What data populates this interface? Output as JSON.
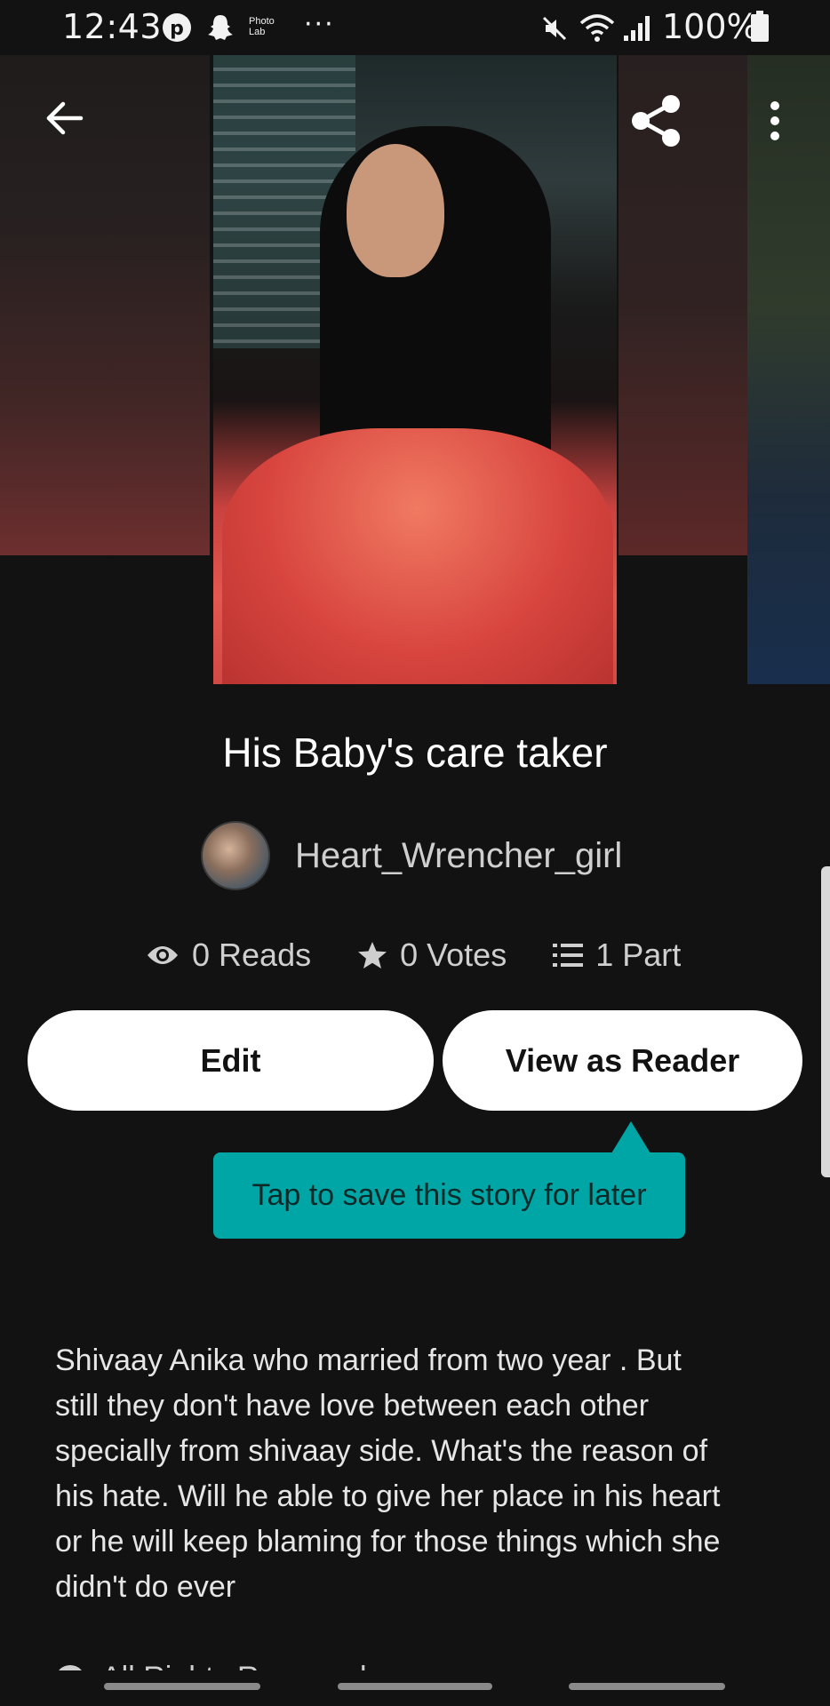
{
  "status_bar": {
    "time": "12:43",
    "app_icons": [
      "pinterest-icon",
      "snapchat-icon",
      "photo-lab-icon"
    ],
    "photo_lab_label": "Photo\nLab",
    "more_indicator": "···",
    "system_icons": [
      "mute-icon",
      "wifi-icon",
      "signal-icon"
    ],
    "battery": "100%"
  },
  "toolbar": {
    "back_icon": "arrow-left-icon",
    "share_icon": "share-icon",
    "more_icon": "more-vertical-icon"
  },
  "story": {
    "title": "His Baby's care taker",
    "author": "Heart_Wrencher_girl",
    "stats": {
      "reads": "0 Reads",
      "votes": "0 Votes",
      "parts": "1 Part"
    },
    "description": "Shivaay Anika who married  from two year .  But\nstill they don't have love between each other\nspecially from shivaay side. What's the reason of\nhis hate. Will he able to give her place in his heart\nor he will keep blaming for those things which she\ndidn't do ever",
    "cut_off_label": "All Rights Reserved"
  },
  "actions": {
    "edit_label": "Edit",
    "view_as_reader_label": "View as Reader"
  },
  "tooltip": {
    "text": "Tap to save this story for later"
  },
  "colors": {
    "background": "#121212",
    "tooltip": "#00a6a6",
    "button_bg": "#ffffff",
    "secondary_text": "#cfcfcf"
  }
}
